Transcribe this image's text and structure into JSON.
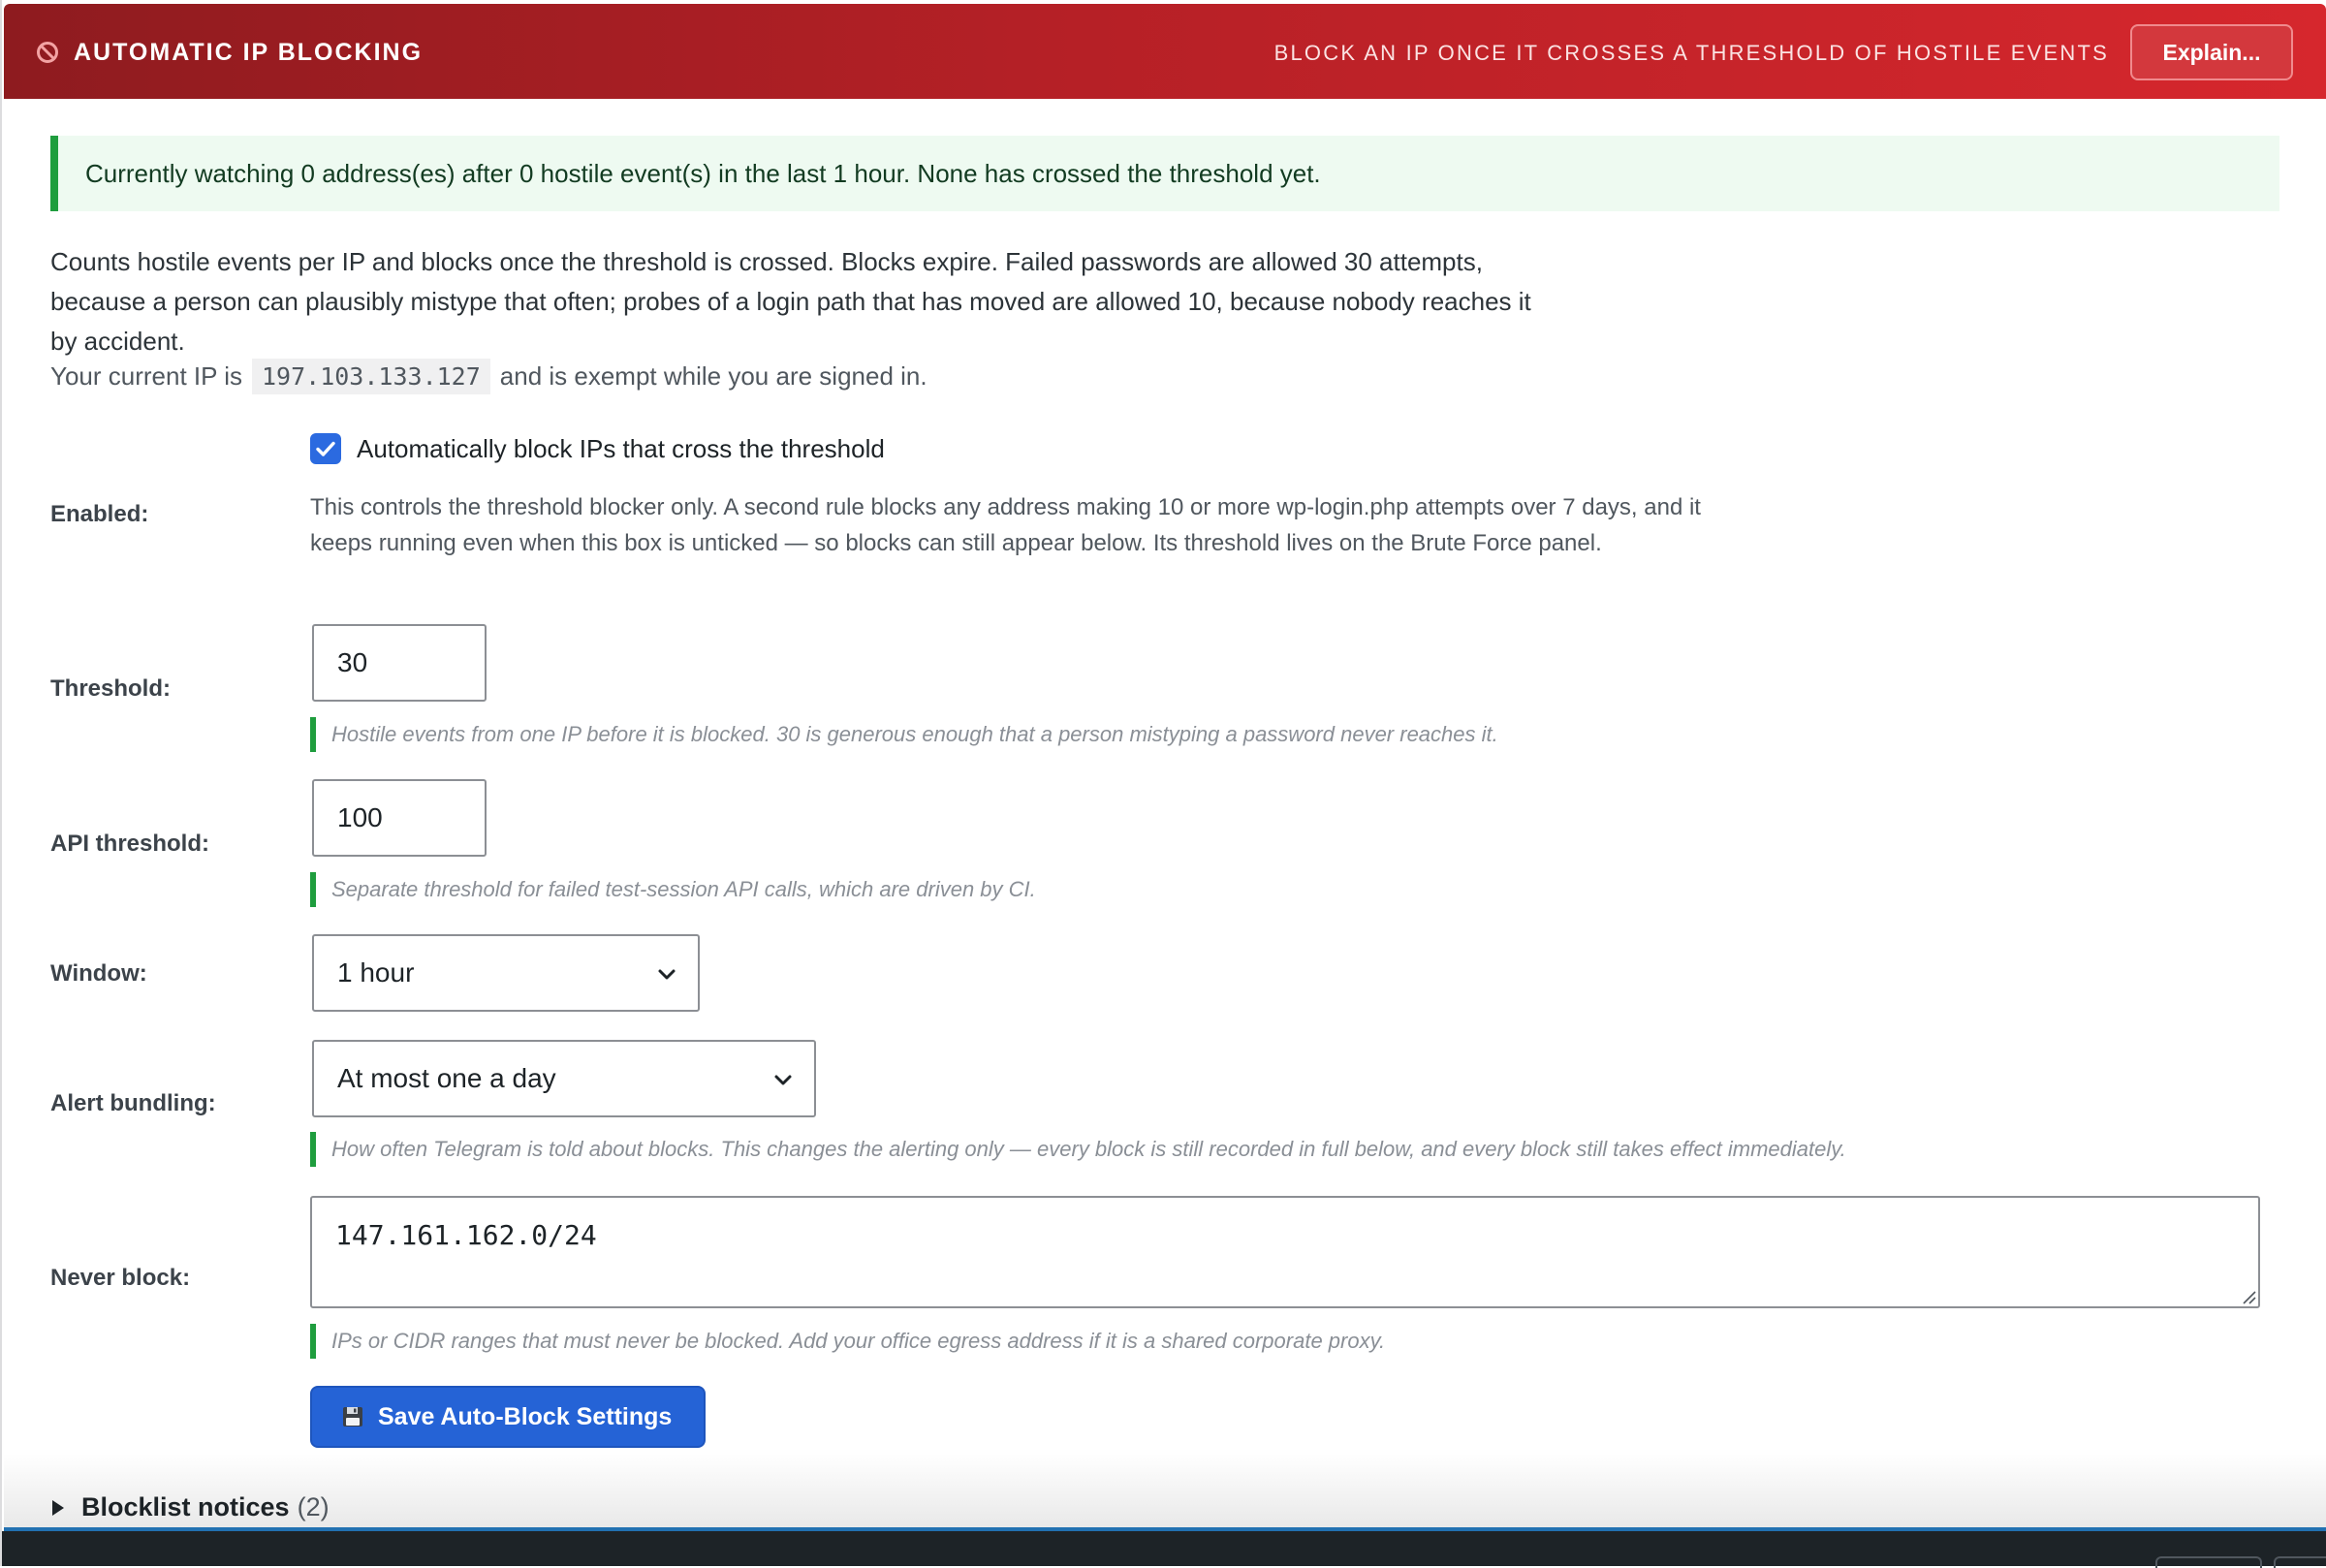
{
  "header": {
    "title": "AUTOMATIC IP BLOCKING",
    "tagline": "BLOCK AN IP ONCE IT CROSSES A THRESHOLD OF HOSTILE EVENTS",
    "explain_label": "Explain...",
    "icon": "block-icon"
  },
  "notice": {
    "text": "Currently watching 0 address(es) after 0 hostile event(s) in the last 1 hour. None has crossed the threshold yet."
  },
  "intro": {
    "text": "Counts hostile events per IP and blocks once the threshold is crossed. Blocks expire. Failed passwords are allowed 30 attempts, because a person can plausibly mistype that often; probes of a login path that has moved are allowed 10, because nobody reaches it by accident.",
    "ip_prefix": "Your current IP is",
    "ip": "197.103.133.127",
    "ip_suffix": "and is exempt while you are signed in."
  },
  "enabled": {
    "label": "Enabled:",
    "checked": true,
    "checkbox_label": "Automatically block IPs that cross the threshold",
    "description": "This controls the threshold blocker only. A second rule blocks any address making 10 or more wp-login.php attempts over 7 days, and it keeps running even when this box is unticked — so blocks can still appear below. Its threshold lives on the Brute Force panel."
  },
  "threshold": {
    "label": "Threshold:",
    "value": "30",
    "hint": "Hostile events from one IP before it is blocked. 30 is generous enough that a person mistyping a password never reaches it."
  },
  "api_threshold": {
    "label": "API threshold:",
    "value": "100",
    "hint": "Separate threshold for failed test-session API calls, which are driven by CI."
  },
  "window": {
    "label": "Window:",
    "selected": "1 hour"
  },
  "alert_bundling": {
    "label": "Alert bundling:",
    "selected": "At most one a day",
    "hint": "How often Telegram is told about blocks. This changes the alerting only — every block is still recorded in full below, and every block still takes effect immediately."
  },
  "never_block": {
    "label": "Never block:",
    "value": "147.161.162.0/24",
    "hint": "IPs or CIDR ranges that must never be blocked. Add your office egress address if it is a shared corporate proxy."
  },
  "save_button": {
    "label": "Save Auto-Block Settings",
    "icon": "floppy-disk-icon"
  },
  "blocklist_notices": {
    "label": "Blocklist notices",
    "count": "(2)"
  },
  "colors": {
    "header_start": "#8e1b1f",
    "header_end": "#d6272d",
    "accent_blue": "#2563d6",
    "success_green": "#1f9d3e"
  }
}
